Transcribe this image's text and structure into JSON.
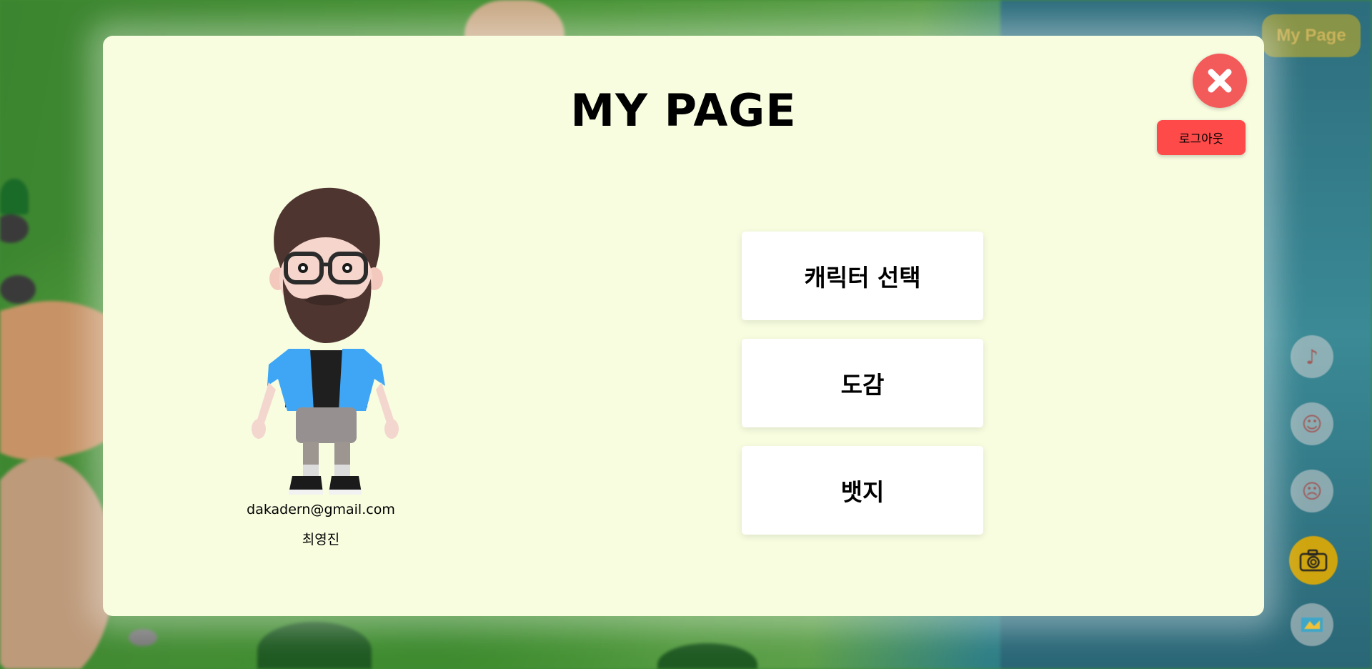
{
  "hud": {
    "mypage_label": "My Page",
    "icons": [
      "dance-icon",
      "friends-icon",
      "emoji-icon",
      "camera-icon",
      "map-icon"
    ],
    "camera_color": "#cfa50f"
  },
  "modal": {
    "title": "MY PAGE",
    "logout_label": "로그아웃",
    "close_color": "#f35a5a",
    "logout_color": "#ff4a4a",
    "background": "#f8fde0"
  },
  "profile": {
    "email": "dakadern@gmail.com",
    "name": "최영진"
  },
  "menu": {
    "items": [
      {
        "label": "캐릭터 선택"
      },
      {
        "label": "도감"
      },
      {
        "label": "뱃지"
      }
    ]
  }
}
